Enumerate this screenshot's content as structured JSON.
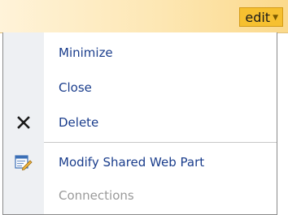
{
  "header": {
    "edit_label": "edit",
    "edit_dropdown_icon": "chevron-down-icon"
  },
  "menu": {
    "items": [
      {
        "label": "Minimize",
        "icon": "",
        "enabled": true
      },
      {
        "label": "Close",
        "icon": "",
        "enabled": true
      },
      {
        "label": "Delete",
        "icon": "delete-x-icon",
        "enabled": true
      },
      {
        "label": "Modify Shared Web Part",
        "icon": "edit-properties-icon",
        "enabled": true
      },
      {
        "label": "Connections",
        "icon": "",
        "enabled": false
      }
    ]
  },
  "colors": {
    "menu_text": "#1a3d8c",
    "disabled_text": "#9a9a9a",
    "edit_button_bg": "#f6c030"
  }
}
